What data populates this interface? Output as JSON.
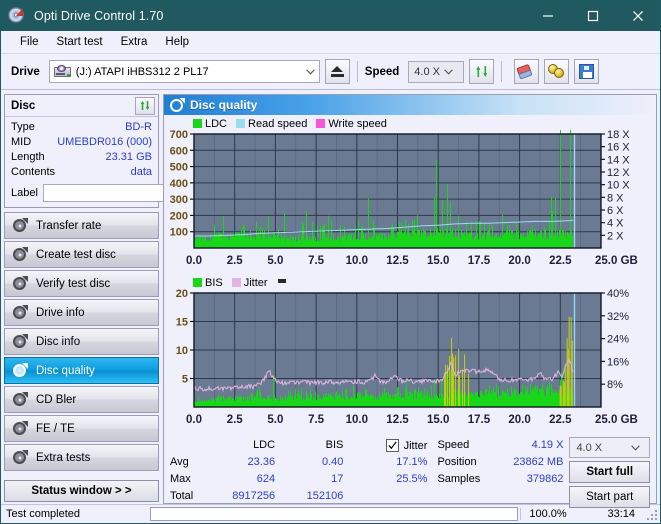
{
  "window": {
    "title": "Opti Drive Control 1.70",
    "icon": "cd-disc-icon",
    "controls": {
      "minimize": "−",
      "maximize": "□",
      "close": "✕"
    },
    "titlebar_color": "#205a60"
  },
  "menu": {
    "items": [
      "File",
      "Start test",
      "Extra",
      "Help"
    ]
  },
  "toolbar": {
    "drive_label": "Drive",
    "drive_value": "(J:)   ATAPI iHBS312  2 PL17",
    "eject_title": "Eject",
    "speed_label": "Speed",
    "speed_value": "4.0 X",
    "refresh_icon": "refresh-icon",
    "erase_icon": "eraser-icon",
    "gold_icon": "coins-icon",
    "save_icon": "floppy-save-icon"
  },
  "disc": {
    "header": "Disc",
    "refresh_icon": "refresh-icon",
    "rows": [
      {
        "key": "Type",
        "value": "BD-R"
      },
      {
        "key": "MID",
        "value": "UMEBDR016 (000)"
      },
      {
        "key": "Length",
        "value": "23.31 GB"
      },
      {
        "key": "Contents",
        "value": "data"
      }
    ],
    "label_key": "Label",
    "label_value": "",
    "label_placeholder": ""
  },
  "nav": {
    "items": [
      {
        "label": "Transfer rate",
        "active": false
      },
      {
        "label": "Create test disc",
        "active": false
      },
      {
        "label": "Verify test disc",
        "active": false
      },
      {
        "label": "Drive info",
        "active": false
      },
      {
        "label": "Disc info",
        "active": false
      },
      {
        "label": "Disc quality",
        "active": true
      },
      {
        "label": "CD Bler",
        "active": false
      },
      {
        "label": "FE / TE",
        "active": false
      },
      {
        "label": "Extra tests",
        "active": false
      }
    ],
    "status_window": "Status window > >"
  },
  "panel": {
    "title": "Disc quality",
    "icon": "disc-quality-icon"
  },
  "stats": {
    "row_labels": [
      "Avg",
      "Max",
      "Total"
    ],
    "columns": [
      {
        "header": "LDC",
        "values": [
          "23.36",
          "624",
          "8917256"
        ]
      },
      {
        "header": "BIS",
        "values": [
          "0.40",
          "17",
          "152106"
        ]
      }
    ],
    "jitter": {
      "header": "Jitter",
      "checked": true,
      "avg": "17.1%",
      "max": "25.5%"
    },
    "right": [
      {
        "key": "Speed",
        "value": "4.19 X"
      },
      {
        "key": "Position",
        "value": "23862 MB"
      },
      {
        "key": "Samples",
        "value": "379862"
      }
    ],
    "speed_select": "4.0 X",
    "start_full": "Start full",
    "start_part": "Start part"
  },
  "statusbar": {
    "text": "Test completed",
    "percent": "100.0%",
    "progress": 100,
    "time": "33:14",
    "bar_color": "#11a811"
  },
  "colors": {
    "ldc": "#18d618",
    "bis": "#18d618",
    "read_speed": "#9adcf2",
    "write_speed": "#f757d8",
    "jitter": "#e0b6e0",
    "plot_bg": "#6b7a93",
    "grid": "#3a4557",
    "accent_blue": "#2b3fd0"
  },
  "chart_data": [
    {
      "type": "area",
      "title": "Disc quality - LDC",
      "xlabel": "GB",
      "ylabel": "LDC",
      "xlim": [
        0.0,
        25.0
      ],
      "ylim": [
        0,
        700
      ],
      "xticks": [
        "0.0",
        "2.5",
        "5.0",
        "7.5",
        "10.0",
        "12.5",
        "15.0",
        "17.5",
        "20.0",
        "22.5",
        "25.0 GB"
      ],
      "yticks": [
        100,
        200,
        300,
        400,
        500,
        600,
        700
      ],
      "y2label": "Speed",
      "y2lim": [
        0,
        18
      ],
      "y2ticks": [
        "2 X",
        "4 X",
        "6 X",
        "8 X",
        "10 X",
        "12 X",
        "14 X",
        "16 X",
        "18 X"
      ],
      "grid": true,
      "legend_position": "top-left",
      "legend": [
        {
          "name": "LDC",
          "color": "#18d618"
        },
        {
          "name": "Read speed",
          "color": "#9adcf2"
        },
        {
          "name": "Write speed",
          "color": "#f757d8"
        }
      ],
      "data_end_gb": 23.31,
      "series": [
        {
          "name": "LDC",
          "type": "area",
          "color": "#18d618",
          "x": [
            0.0,
            0.1,
            0.25,
            0.4,
            0.6,
            0.8,
            1.0,
            1.2,
            1.35,
            1.5,
            1.7,
            1.9,
            2.1,
            2.3,
            2.4,
            2.55,
            2.7,
            2.9,
            3.1,
            3.3,
            3.5,
            3.7,
            3.9,
            4.1,
            4.3,
            4.5,
            4.7,
            4.9,
            5.0,
            5.15,
            5.3,
            5.5,
            5.7,
            5.9,
            6.1,
            6.3,
            6.5,
            6.7,
            6.9,
            7.1,
            7.3,
            7.5,
            7.7,
            7.9,
            8.1,
            8.3,
            8.5,
            8.7,
            8.9,
            9.1,
            9.3,
            9.5,
            9.7,
            9.9,
            10.1,
            10.3,
            10.5,
            10.7,
            10.9,
            11.1,
            11.3,
            11.5,
            11.7,
            11.9,
            12.1,
            12.3,
            12.5,
            12.7,
            12.9,
            13.1,
            13.3,
            13.5,
            13.7,
            13.9,
            14.1,
            14.3,
            14.5,
            14.7,
            14.9,
            15.1,
            15.3,
            15.5,
            15.7,
            15.9,
            16.1,
            16.3,
            16.5,
            16.7,
            16.9,
            17.1,
            17.3,
            17.5,
            17.7,
            17.9,
            18.1,
            18.3,
            18.5,
            18.7,
            18.9,
            19.1,
            19.3,
            19.5,
            19.7,
            19.9,
            20.1,
            20.3,
            20.5,
            20.7,
            20.9,
            21.1,
            21.3,
            21.5,
            21.7,
            21.9,
            22.1,
            22.3,
            22.5,
            22.7,
            22.9,
            23.1,
            23.3
          ],
          "y": [
            430,
            95,
            70,
            75,
            65,
            60,
            70,
            320,
            80,
            70,
            75,
            300,
            90,
            80,
            60,
            65,
            70,
            120,
            150,
            180,
            160,
            320,
            130,
            110,
            95,
            330,
            150,
            100,
            90,
            130,
            110,
            230,
            170,
            150,
            200,
            180,
            160,
            190,
            210,
            170,
            190,
            150,
            170,
            200,
            180,
            310,
            180,
            160,
            150,
            170,
            160,
            180,
            150,
            170,
            160,
            180,
            170,
            410,
            150,
            170,
            160,
            190,
            175,
            165,
            185,
            170,
            200,
            180,
            190,
            175,
            185,
            195,
            180,
            205,
            230,
            250,
            515,
            300,
            630,
            560,
            480,
            420,
            300,
            560,
            260,
            220,
            330,
            190,
            170,
            175,
            185,
            195,
            175,
            185,
            165,
            180,
            290,
            190,
            200,
            185,
            175,
            195,
            185,
            180,
            210,
            300,
            190,
            175,
            165,
            185,
            175,
            180,
            200,
            300,
            340,
            490,
            200
          ]
        },
        {
          "name": "Read speed",
          "type": "line",
          "color": "#9adcf2",
          "axis": "right",
          "x": [
            0.0,
            1.0,
            2.0,
            3.0,
            4.0,
            5.0,
            6.0,
            7.0,
            8.0,
            9.0,
            10.0,
            11.0,
            12.0,
            13.0,
            14.0,
            15.0,
            16.0,
            17.0,
            18.0,
            19.0,
            20.0,
            21.0,
            22.0,
            23.0,
            23.3,
            23.35
          ],
          "y": [
            1.9,
            1.9,
            2.0,
            2.1,
            2.3,
            2.4,
            2.5,
            2.6,
            2.7,
            2.8,
            2.9,
            3.0,
            3.1,
            3.3,
            3.5,
            3.6,
            3.8,
            3.9,
            3.9,
            4.0,
            4.1,
            4.2,
            4.2,
            4.3,
            4.4,
            18.0
          ]
        },
        {
          "name": "Write speed",
          "type": "line",
          "color": "#f757d8",
          "x": [],
          "y": []
        }
      ]
    },
    {
      "type": "area",
      "title": "Disc quality - BIS / Jitter",
      "xlabel": "GB",
      "ylabel": "BIS",
      "xlim": [
        0.0,
        25.0
      ],
      "ylim": [
        0,
        20
      ],
      "xticks": [
        "0.0",
        "2.5",
        "5.0",
        "7.5",
        "10.0",
        "12.5",
        "15.0",
        "17.5",
        "20.0",
        "22.5",
        "25.0 GB"
      ],
      "yticks": [
        5,
        10,
        15,
        20
      ],
      "y2label": "Jitter",
      "y2lim": [
        0,
        40
      ],
      "y2ticks": [
        "8%",
        "16%",
        "24%",
        "32%",
        "40%"
      ],
      "grid": true,
      "legend_position": "top-left",
      "legend": [
        {
          "name": "BIS",
          "color": "#18d618"
        },
        {
          "name": "Jitter",
          "color": "#e0b6e0"
        }
      ],
      "data_end_gb": 23.31,
      "series": [
        {
          "name": "BIS",
          "type": "area",
          "color": "#18d618",
          "x": [
            0.0,
            0.15,
            0.3,
            0.5,
            0.7,
            0.9,
            1.1,
            1.3,
            1.5,
            1.7,
            1.9,
            2.1,
            2.3,
            2.5,
            2.7,
            2.9,
            3.1,
            3.3,
            3.5,
            3.7,
            3.9,
            4.1,
            4.3,
            4.5,
            4.7,
            4.9,
            5.0,
            5.2,
            5.4,
            5.6,
            5.8,
            6.0,
            6.2,
            6.4,
            6.6,
            6.8,
            7.0,
            7.2,
            7.4,
            7.6,
            7.8,
            8.0,
            8.2,
            8.4,
            8.6,
            8.8,
            9.0,
            9.2,
            9.4,
            9.6,
            9.8,
            10.0,
            10.2,
            10.4,
            10.6,
            10.8,
            11.0,
            11.2,
            11.4,
            11.6,
            11.8,
            12.0,
            12.2,
            12.4,
            12.6,
            12.8,
            13.0,
            13.2,
            13.4,
            13.6,
            13.8,
            14.0,
            14.2,
            14.4,
            14.6,
            14.8,
            15.0,
            15.2,
            15.4,
            15.6,
            15.8,
            16.0,
            16.2,
            16.4,
            16.6,
            16.8,
            17.0,
            17.2,
            17.4,
            17.6,
            17.8,
            18.0,
            18.2,
            18.4,
            18.6,
            18.8,
            19.0,
            19.2,
            19.4,
            19.6,
            19.8,
            20.0,
            20.2,
            20.4,
            20.6,
            20.8,
            21.0,
            21.2,
            21.4,
            21.6,
            21.8,
            22.0,
            22.2,
            22.4,
            22.6,
            22.8,
            23.0,
            23.2,
            23.3
          ],
          "y": [
            2.0,
            3.0,
            2.5,
            2.0,
            1.8,
            2.2,
            5.0,
            2.0,
            2.4,
            2.0,
            2.8,
            2.2,
            5.5,
            2.0,
            2.5,
            2.2,
            3.0,
            2.6,
            3.0,
            2.8,
            3.2,
            3.0,
            3.4,
            3.0,
            4.0,
            6.8,
            3.6,
            3.2,
            3.4,
            3.0,
            3.6,
            3.2,
            3.8,
            3.4,
            3.6,
            3.2,
            3.8,
            3.4,
            4.0,
            3.6,
            3.8,
            3.4,
            5.8,
            3.6,
            3.8,
            3.4,
            4.0,
            3.6,
            3.8,
            3.4,
            4.0,
            3.6,
            3.8,
            4.0,
            3.6,
            4.2,
            3.8,
            4.0,
            3.6,
            4.2,
            3.8,
            4.0,
            4.2,
            3.8,
            4.4,
            4.0,
            4.2,
            3.8,
            4.4,
            4.0,
            4.2,
            4.4,
            4.0,
            4.2,
            4.4,
            4.6,
            4.2,
            5.0,
            8.0,
            6.5,
            10.0,
            7.0,
            9.0,
            7.5,
            8.5,
            6.5,
            7.0,
            5.0,
            4.5,
            4.2,
            4.4,
            3.8,
            4.2,
            4.0,
            4.4,
            4.0,
            4.6,
            4.2,
            4.4,
            4.0,
            4.2,
            3.8,
            4.4,
            4.0,
            4.2,
            5.8,
            4.4,
            4.0,
            4.2,
            3.8,
            4.4,
            4.6,
            4.2,
            5.0,
            5.5,
            8.0,
            12.0,
            15.5,
            10.0
          ]
        },
        {
          "name": "Jitter",
          "type": "line",
          "color": "#e0b6e0",
          "axis": "right",
          "x": [
            0.0,
            0.2,
            0.4,
            0.6,
            0.8,
            1.0,
            1.2,
            1.4,
            1.6,
            1.8,
            2.0,
            2.2,
            2.4,
            2.6,
            2.8,
            3.0,
            3.2,
            3.4,
            3.6,
            3.8,
            4.0,
            4.2,
            4.4,
            4.6,
            4.8,
            4.9,
            5.0,
            5.2,
            5.4,
            5.6,
            5.8,
            6.0,
            6.4,
            6.8,
            7.2,
            7.6,
            8.0,
            8.4,
            8.8,
            9.2,
            9.6,
            10.0,
            10.4,
            10.8,
            11.2,
            11.4,
            11.6,
            12.0,
            12.4,
            12.8,
            13.0,
            13.4,
            13.8,
            14.2,
            14.6,
            15.0,
            15.4,
            15.8,
            16.0,
            16.4,
            16.8,
            17.2,
            17.6,
            18.0,
            18.4,
            18.8,
            19.2,
            19.6,
            20.0,
            20.4,
            20.8,
            21.2,
            21.6,
            22.0,
            22.4,
            22.6,
            22.8,
            23.0,
            23.2,
            23.3
          ],
          "y": [
            7.0,
            6.2,
            6.4,
            6.2,
            6.3,
            6.6,
            6.4,
            6.8,
            6.6,
            6.5,
            7.0,
            6.6,
            6.4,
            6.8,
            6.6,
            7.0,
            6.8,
            7.2,
            7.0,
            7.4,
            8.0,
            9.0,
            10.5,
            12.8,
            11.0,
            10.2,
            9.2,
            8.6,
            8.4,
            8.6,
            8.4,
            8.6,
            8.4,
            8.6,
            8.5,
            8.7,
            8.5,
            8.8,
            8.6,
            8.8,
            8.7,
            8.9,
            8.7,
            9.0,
            11.5,
            9.0,
            8.8,
            9.2,
            10.8,
            9.0,
            9.4,
            9.0,
            9.2,
            9.0,
            9.3,
            9.0,
            10.2,
            16.2,
            11.0,
            13.0,
            12.8,
            12.5,
            12.6,
            12.8,
            11.5,
            9.5,
            9.6,
            9.4,
            9.6,
            9.4,
            9.6,
            12.2,
            9.6,
            9.8,
            12.2,
            11.0,
            13.5,
            17.2,
            14.0,
            11.0
          ]
        }
      ]
    }
  ]
}
